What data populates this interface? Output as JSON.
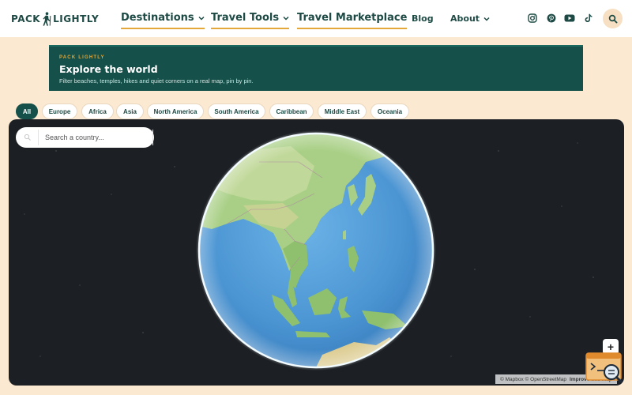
{
  "brand": {
    "name_left": "PACK",
    "name_right": "LIGHTLY"
  },
  "nav": {
    "destinations": "Destinations",
    "travel_tools": "Travel Tools",
    "marketplace": "Travel Marketplace",
    "blog": "Blog",
    "about": "About"
  },
  "social_icons": [
    "instagram-icon",
    "pinterest-icon",
    "youtube-icon",
    "tiktok-icon"
  ],
  "banner": {
    "kicker": "PACK LIGHTLY",
    "title": "Explore the world",
    "subtitle": "Filter beaches, temples, hikes and quiet corners on a real map, pin by pin."
  },
  "filters": {
    "selected": "All",
    "items": [
      "All",
      "Europe",
      "Africa",
      "Asia",
      "North America",
      "South America",
      "Caribbean",
      "Middle East",
      "Oceania"
    ]
  },
  "map": {
    "search_placeholder": "Search a country...",
    "zoom_in_label": "+",
    "attribution_a": "© Mapbox",
    "attribution_b": "© OpenStreetMap",
    "attribution_c": "Improve this map"
  },
  "colors": {
    "brand_dark": "#15514a",
    "accent": "#e3a73a",
    "page_bg": "#fbe9d2",
    "map_bg": "#1c2024",
    "ocean": "#4d9ad8",
    "land": "#a9cf85"
  }
}
